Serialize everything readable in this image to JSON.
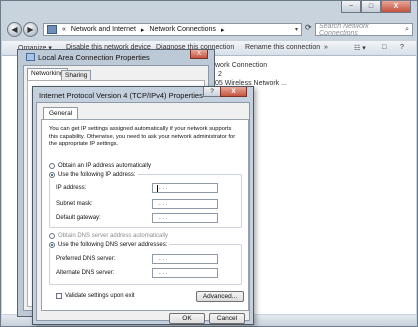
{
  "explorer": {
    "window_controls": {
      "minimize": "−",
      "maximize": "□",
      "close": "X"
    },
    "nav": {
      "back": "◀",
      "forward": "▶"
    },
    "breadcrumb": {
      "prefix": "«",
      "item1": "Network and Internet",
      "sep": "▸",
      "item2": "Network Connections",
      "sep2": "▸"
    },
    "search": {
      "placeholder": "Search Network Connections",
      "icon": "⌕"
    },
    "toolbar": {
      "organize": "Organize ▾",
      "disable": "Disable this network device",
      "diagnose": "Diagnose this connection",
      "rename": "Rename this connection",
      "more": "»",
      "views": "☷ ▾",
      "preview": "□",
      "help": "?"
    },
    "connections": {
      "name": "work Connection",
      "line2": "2",
      "line3": "05 Wireless Network ..."
    }
  },
  "lac_dialog": {
    "title": "Local Area Connection Properties",
    "close": "X",
    "tabs": [
      "Networking",
      "Sharing"
    ]
  },
  "ipv4_dialog": {
    "title": "Internet Protocol Version 4 (TCP/IPv4) Properties",
    "help": "?",
    "close": "X",
    "tab": "General",
    "description": "You can get IP settings assigned automatically if your network supports this capability. Otherwise, you need to ask your network administrator for the appropriate IP settings.",
    "ip_section": {
      "auto_label": "Obtain an IP address automatically",
      "auto_selected": false,
      "manual_label": "Use the following IP address:",
      "manual_selected": true,
      "fields": [
        {
          "label": "IP address:",
          "value": " .   .   . "
        },
        {
          "label": "Subnet mask:",
          "value": " .   .   . "
        },
        {
          "label": "Default gateway:",
          "value": " .   .   . "
        }
      ]
    },
    "dns_section": {
      "auto_label": "Obtain DNS server address automatically",
      "auto_selected": false,
      "manual_label": "Use the following DNS server addresses:",
      "manual_selected": true,
      "fields": [
        {
          "label": "Preferred DNS server:",
          "value": " .   .   . "
        },
        {
          "label": "Alternate DNS server:",
          "value": " .   .   . "
        }
      ]
    },
    "validate_label": "Validate settings upon exit",
    "validate_checked": false,
    "advanced_button": "Advanced...",
    "ok_button": "OK",
    "cancel_button": "Cancel"
  }
}
